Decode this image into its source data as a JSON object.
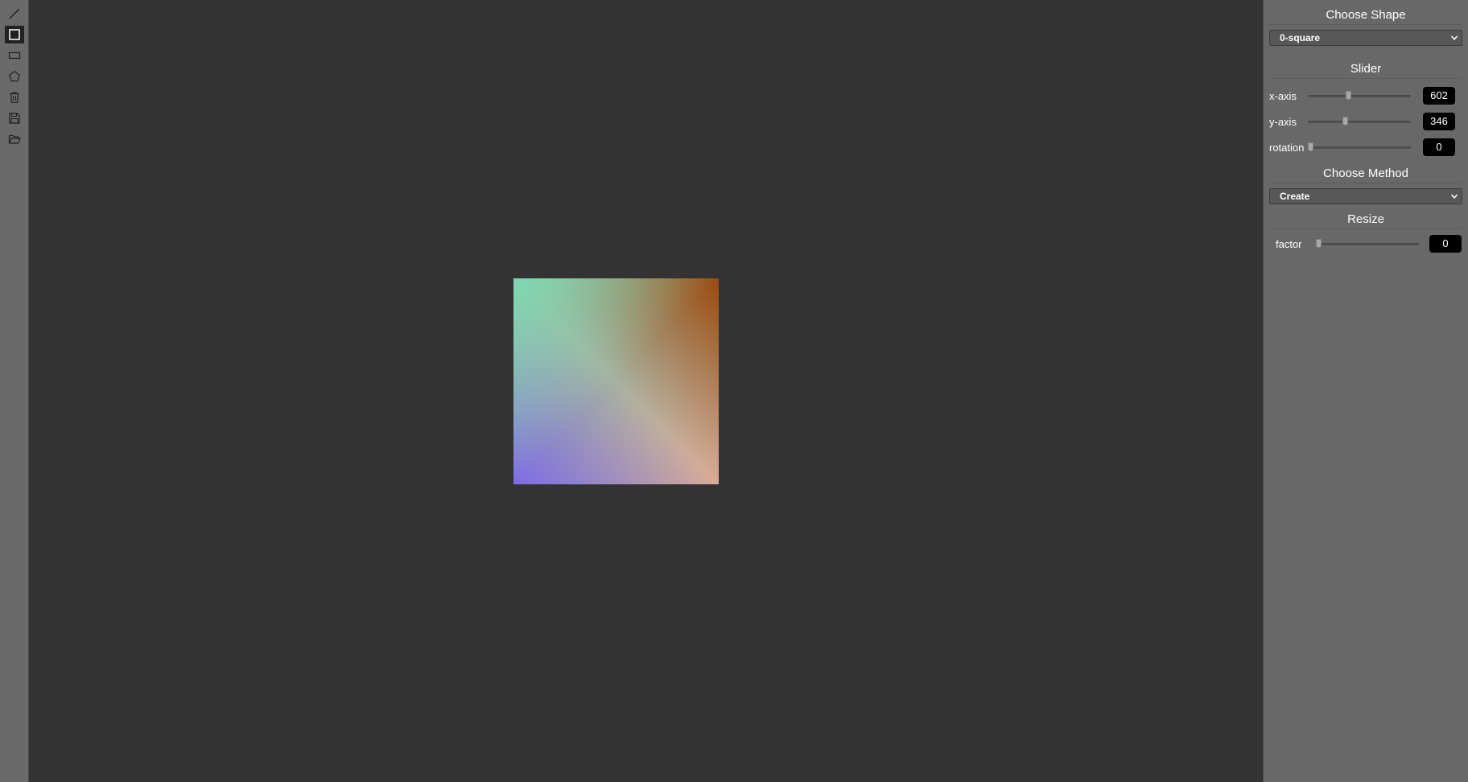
{
  "toolbar": {
    "tools": [
      {
        "icon": "line-icon",
        "active": false
      },
      {
        "icon": "square-icon",
        "active": true
      },
      {
        "icon": "rectangle-icon",
        "active": false
      },
      {
        "icon": "pentagon-icon",
        "active": false
      },
      {
        "icon": "trash-icon",
        "active": false
      },
      {
        "icon": "save-icon",
        "active": false
      },
      {
        "icon": "folder-open-icon",
        "active": false
      }
    ]
  },
  "canvas": {
    "shape": {
      "type": "square",
      "gradient_colors": {
        "top_left": "#7ed8b2",
        "top_right": "#9c4a0c",
        "bottom_left": "#7e6ce4",
        "bottom_right": "#dcaa96"
      }
    }
  },
  "panel": {
    "choose_shape": {
      "title": "Choose Shape",
      "selected": "0-square"
    },
    "slider": {
      "title": "Slider",
      "x_axis": {
        "label": "x-axis",
        "value": "602",
        "fraction": 0.39
      },
      "y_axis": {
        "label": "y-axis",
        "value": "346",
        "fraction": 0.36
      },
      "rotation": {
        "label": "rotation",
        "value": "0",
        "fraction": 0.0
      }
    },
    "choose_method": {
      "title": "Choose Method",
      "selected": "Create"
    },
    "resize": {
      "title": "Resize",
      "factor": {
        "label": "factor",
        "value": "0",
        "fraction": 0.0
      }
    }
  },
  "colors": {
    "canvas_bg": "#333333",
    "panel_bg": "#686868",
    "toolbar_bg": "#6a6a6a",
    "value_box_bg": "#000000"
  }
}
